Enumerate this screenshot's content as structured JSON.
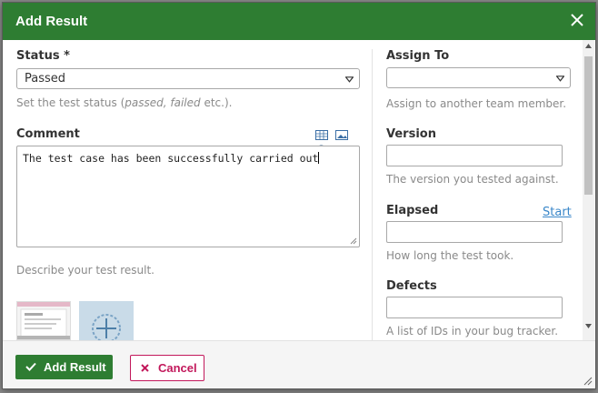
{
  "dialog": {
    "title": "Add Result"
  },
  "left": {
    "status_label": "Status *",
    "status_value": "Passed",
    "status_hint_prefix": "Set the test status (",
    "status_hint_italic": "passed, failed",
    "status_hint_suffix": " etc.).",
    "comment_label": "Comment",
    "comment_value": "The test case has been successfully carried out",
    "comment_hint": "Describe your test result."
  },
  "right": {
    "assign_label": "Assign To",
    "assign_value": "",
    "assign_hint": "Assign to another team member.",
    "version_label": "Version",
    "version_value": "",
    "version_hint": "The version you tested against.",
    "elapsed_label": "Elapsed",
    "elapsed_value": "",
    "elapsed_start": "Start",
    "elapsed_hint": "How long the test took.",
    "defects_label": "Defects",
    "defects_value": "",
    "defects_hint": "A list of IDs in your bug tracker."
  },
  "footer": {
    "add_label": "Add Result",
    "cancel_label": "Cancel"
  },
  "colors": {
    "header": "#2e7d32",
    "primary_button": "#2e7d32",
    "cancel": "#c2185b",
    "link": "#3a87c9"
  }
}
